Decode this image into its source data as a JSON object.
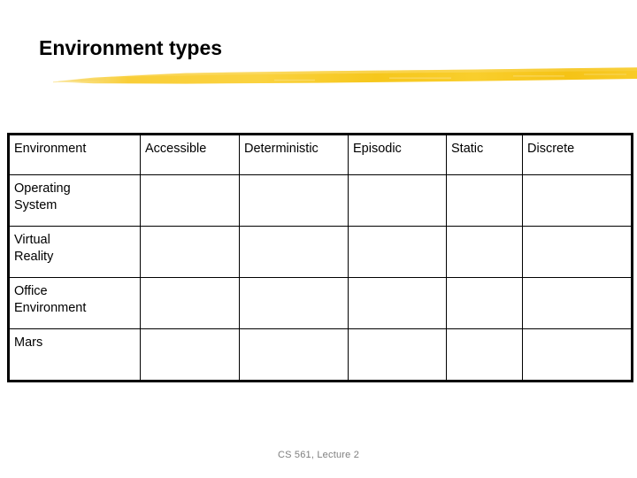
{
  "slide": {
    "title": "Environment types",
    "footer": "CS 561,  Lecture 2",
    "accent_color": "#F5C518",
    "title_color": "#000000",
    "footer_color": "#7F7F7F",
    "background_color": "#FFFFFF",
    "decoration": "yellow-brush-stroke-underline"
  },
  "table": {
    "columns": [
      {
        "label": "Environment"
      },
      {
        "label": "Accessible"
      },
      {
        "label": "Deterministic"
      },
      {
        "label": "Episodic"
      },
      {
        "label": "Static"
      },
      {
        "label": "Discrete"
      }
    ],
    "rows": [
      {
        "label_lines": [
          "Operating",
          "System"
        ],
        "spacing": "tight",
        "cells": [
          "",
          "",
          "",
          "",
          ""
        ]
      },
      {
        "label_lines": [
          "Virtual",
          "Reality"
        ],
        "spacing": "loose",
        "cells": [
          "",
          "",
          "",
          "",
          ""
        ]
      },
      {
        "label_lines": [
          "Office",
          "Environment"
        ],
        "spacing": "tight",
        "cells": [
          "",
          "",
          "",
          "",
          ""
        ]
      },
      {
        "label_lines": [
          "Mars",
          ""
        ],
        "spacing": "tight",
        "cells": [
          "",
          "",
          "",
          "",
          ""
        ]
      }
    ]
  }
}
